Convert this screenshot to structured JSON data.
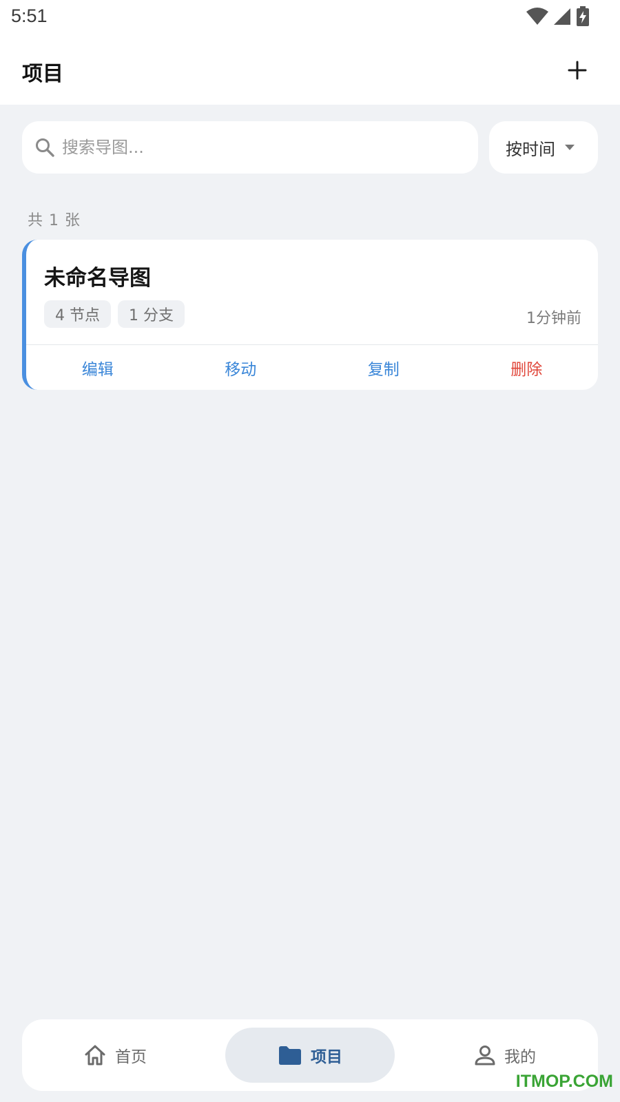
{
  "status_bar": {
    "time": "5:51"
  },
  "header": {
    "title": "项目"
  },
  "search": {
    "placeholder": "搜索导图..."
  },
  "sort": {
    "label": "按时间"
  },
  "list": {
    "count_text": "共 1 张",
    "cards": [
      {
        "title": "未命名导图",
        "tags": [
          "4 节点",
          "1 分支"
        ],
        "time": "1分钟前",
        "actions": {
          "edit": "编辑",
          "move": "移动",
          "copy": "复制",
          "delete": "删除"
        }
      }
    ]
  },
  "bottom_nav": {
    "items": [
      {
        "label": "首页",
        "icon": "home-icon",
        "active": false
      },
      {
        "label": "项目",
        "icon": "folder-icon",
        "active": true
      },
      {
        "label": "我的",
        "icon": "person-icon",
        "active": false
      }
    ]
  },
  "watermark": "ITMOP.COM",
  "colors": {
    "accent": "#3a86d8",
    "card_accent_bar": "#4a8fe0",
    "danger": "#e0473b",
    "nav_active": "#2e5e95",
    "background": "#f0f2f5"
  }
}
